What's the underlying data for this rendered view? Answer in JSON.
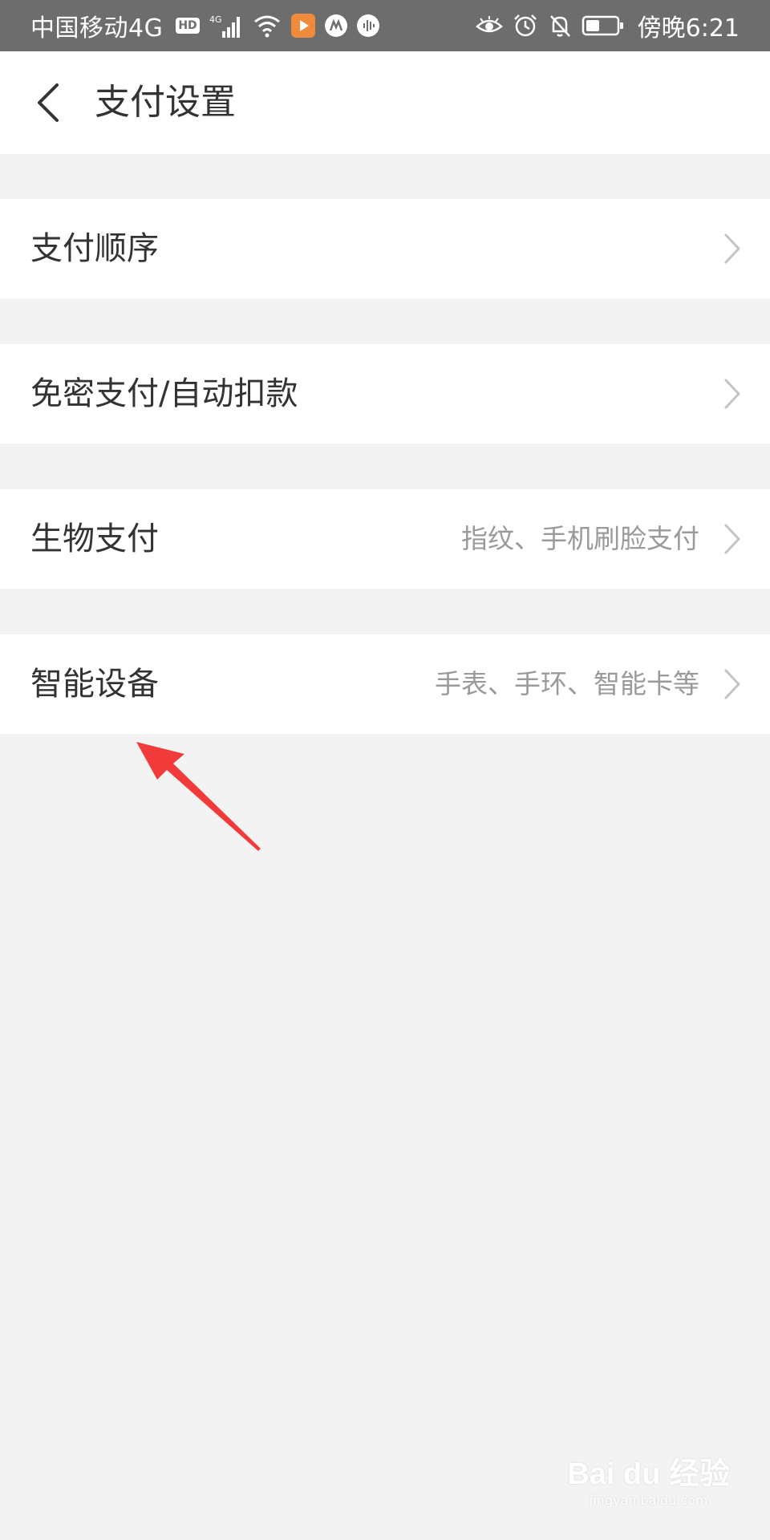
{
  "status_bar": {
    "carrier": "中国移动4G",
    "hd_badge": "HD",
    "network_label": "4G",
    "time": "傍晚6:21",
    "icons": [
      "hd-icon",
      "signal-icon",
      "wifi-icon",
      "app-icon-orange",
      "app-icon-white",
      "voice-app-icon",
      "eye-icon",
      "alarm-icon",
      "mute-bell-icon",
      "battery-icon"
    ]
  },
  "header": {
    "back_icon": "chevron-left-icon",
    "title": "支付设置"
  },
  "rows": [
    {
      "label": "支付顺序",
      "sub": ""
    },
    {
      "label": "免密支付/自动扣款",
      "sub": ""
    },
    {
      "label": "生物支付",
      "sub": "指纹、手机刷脸支付"
    },
    {
      "label": "智能设备",
      "sub": "手表、手环、智能卡等"
    }
  ],
  "colors": {
    "status_bar_bg": "#6d6d6d",
    "page_bg": "#f3f3f3",
    "row_bg": "#ffffff",
    "primary_text": "#333333",
    "secondary_text": "#9a9a9a",
    "chevron": "#c4c4c4",
    "annotation_arrow": "#f23a3a"
  },
  "watermark": {
    "logo": "Bai du 经验",
    "url": "jingyan.baidu.com"
  }
}
